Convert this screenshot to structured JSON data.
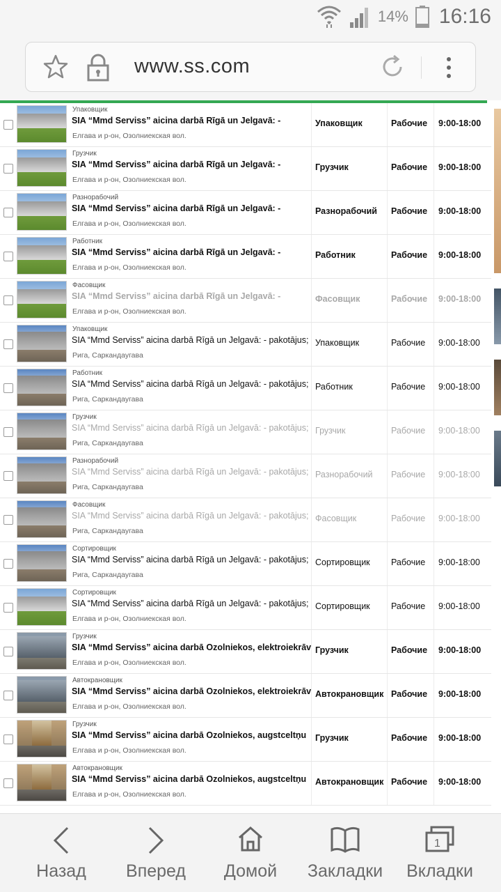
{
  "status_bar": {
    "battery_pct": "14%",
    "time": "16:16"
  },
  "address_bar": {
    "url": "www.ss.com"
  },
  "listings": [
    {
      "category": "Упаковщик",
      "title": "SIA “Mmd Serviss” aicina darbā Rīgā un Jelgavā: -",
      "location": "Елгава и р-он, Озолниекская вол.",
      "position": "Упаковщик",
      "type": "Рабочие",
      "hours": "9:00-18:00",
      "style": "bold",
      "thumb": "t1"
    },
    {
      "category": "Грузчик",
      "title": "SIA “Mmd Serviss” aicina darbā Rīgā un Jelgavā: -",
      "location": "Елгава и р-он, Озолниекская вол.",
      "position": "Грузчик",
      "type": "Рабочие",
      "hours": "9:00-18:00",
      "style": "bold",
      "thumb": "t1"
    },
    {
      "category": "Разнорабочий",
      "title": "SIA “Mmd Serviss” aicina darbā Rīgā un Jelgavā: -",
      "location": "Елгава и р-он, Озолниекская вол.",
      "position": "Разнорабочий",
      "type": "Рабочие",
      "hours": "9:00-18:00",
      "style": "bold",
      "thumb": "t1"
    },
    {
      "category": "Работник",
      "title": "SIA “Mmd Serviss” aicina darbā Rīgā un Jelgavā: -",
      "location": "Елгава и р-он, Озолниекская вол.",
      "position": "Работник",
      "type": "Рабочие",
      "hours": "9:00-18:00",
      "style": "bold",
      "thumb": "t1"
    },
    {
      "category": "Фасовщик",
      "title": "SIA “Mmd Serviss” aicina darbā Rīgā un Jelgavā: -",
      "location": "Елгава и р-он, Озолниекская вол.",
      "position": "Фасовщик",
      "type": "Рабочие",
      "hours": "9:00-18:00",
      "style": "faded-bold",
      "thumb": "t1"
    },
    {
      "category": "Упаковщик",
      "title": "SIA “Mmd Serviss” aicina darbā Rīgā un Jelgavā: - pakotājus; -",
      "location": "Рига, Саркандаугава",
      "position": "Упаковщик",
      "type": "Рабочие",
      "hours": "9:00-18:00",
      "style": "normal",
      "thumb": "t2"
    },
    {
      "category": "Работник",
      "title": "SIA “Mmd Serviss” aicina darbā Rīgā un Jelgavā: - pakotājus; -",
      "location": "Рига, Саркандаугава",
      "position": "Работник",
      "type": "Рабочие",
      "hours": "9:00-18:00",
      "style": "normal",
      "thumb": "t2"
    },
    {
      "category": "Грузчик",
      "title": "SIA “Mmd Serviss” aicina darbā Rīgā un Jelgavā: - pakotājus; -",
      "location": "Рига, Саркандаугава",
      "position": "Грузчик",
      "type": "Рабочие",
      "hours": "9:00-18:00",
      "style": "faded",
      "thumb": "t2"
    },
    {
      "category": "Разнорабочий",
      "title": "SIA “Mmd Serviss” aicina darbā Rīgā un Jelgavā: - pakotājus; -",
      "location": "Рига, Саркандаугава",
      "position": "Разнорабочий",
      "type": "Рабочие",
      "hours": "9:00-18:00",
      "style": "faded",
      "thumb": "t2"
    },
    {
      "category": "Фасовщик",
      "title": "SIA “Mmd Serviss” aicina darbā Rīgā un Jelgavā: - pakotājus; -",
      "location": "Рига, Саркандаугава",
      "position": "Фасовщик",
      "type": "Рабочие",
      "hours": "9:00-18:00",
      "style": "faded",
      "thumb": "t2"
    },
    {
      "category": "Сортировщик",
      "title": "SIA “Mmd Serviss” aicina darbā Rīgā un Jelgavā: - pakotājus; -",
      "location": "Рига, Саркандаугава",
      "position": "Сортировщик",
      "type": "Рабочие",
      "hours": "9:00-18:00",
      "style": "normal",
      "thumb": "t2"
    },
    {
      "category": "Сортировщик",
      "title": "SIA “Mmd Serviss” aicina darbā Rīgā un Jelgavā: - pakotājus; -",
      "location": "Елгава и р-он, Озолниекская вол.",
      "position": "Сортировщик",
      "type": "Рабочие",
      "hours": "9:00-18:00",
      "style": "normal",
      "thumb": "t1"
    },
    {
      "category": "Грузчик",
      "title": "SIA “Mmd Serviss” aicina darbā Ozolniekos, elektroiekrāvēja",
      "location": "Елгава и р-он, Озолниекская вол.",
      "position": "Грузчик",
      "type": "Рабочие",
      "hours": "9:00-18:00",
      "style": "bold",
      "thumb": "t3"
    },
    {
      "category": "Автокрановщик",
      "title": "SIA “Mmd Serviss” aicina darbā Ozolniekos, elektroiekrāvēja",
      "location": "Елгава и р-он, Озолниекская вол.",
      "position": "Автокрановщик",
      "type": "Рабочие",
      "hours": "9:00-18:00",
      "style": "bold",
      "thumb": "t3"
    },
    {
      "category": "Грузчик",
      "title": "SIA “Mmd Serviss” aicina darbā Ozolniekos, augstceltņu",
      "location": "Елгава и р-он, Озолниекская вол.",
      "position": "Грузчик",
      "type": "Рабочие",
      "hours": "9:00-18:00",
      "style": "bold",
      "thumb": "t4"
    },
    {
      "category": "Автокрановщик",
      "title": "SIA “Mmd Serviss” aicina darbā Ozolniekos, augstceltņu",
      "location": "Елгава и р-он, Озолниекская вол.",
      "position": "Автокрановщик",
      "type": "Рабочие",
      "hours": "9:00-18:00",
      "style": "bold",
      "thumb": "t4"
    }
  ],
  "bottom_nav": {
    "back": "Назад",
    "forward": "Вперед",
    "home": "Домой",
    "bookmarks": "Закладки",
    "tabs": "Вкладки",
    "tab_count": "1"
  },
  "colors": {
    "accent_line": "#34a853",
    "faded_text": "#a8a8a8"
  }
}
